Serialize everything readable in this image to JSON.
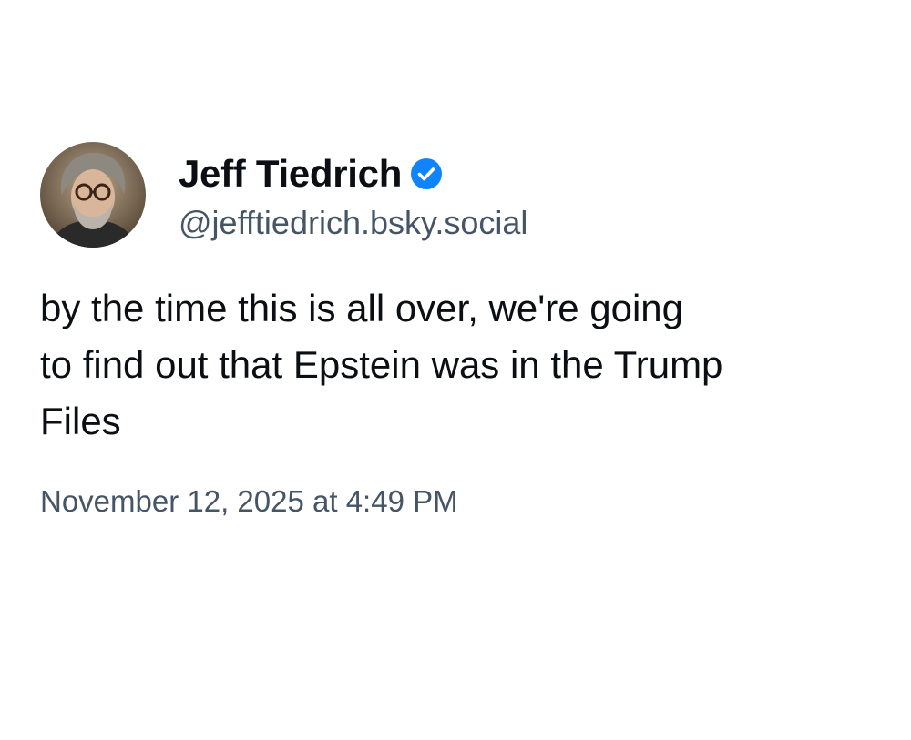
{
  "post": {
    "author": {
      "display_name": "Jeff Tiedrich",
      "handle": "@jefftiedrich.bsky.social",
      "verified": true,
      "avatar_icon": "avatar-photo-icon"
    },
    "text": "by the time this is all over, we're going\nto find out that Epstein was in the Trump\nFiles",
    "timestamp": "November 12, 2025 at 4:49 PM"
  },
  "colors": {
    "background": "#ffffff",
    "text_primary": "#0b0f14",
    "text_secondary": "#465566",
    "verified_badge": "#1083fe"
  }
}
